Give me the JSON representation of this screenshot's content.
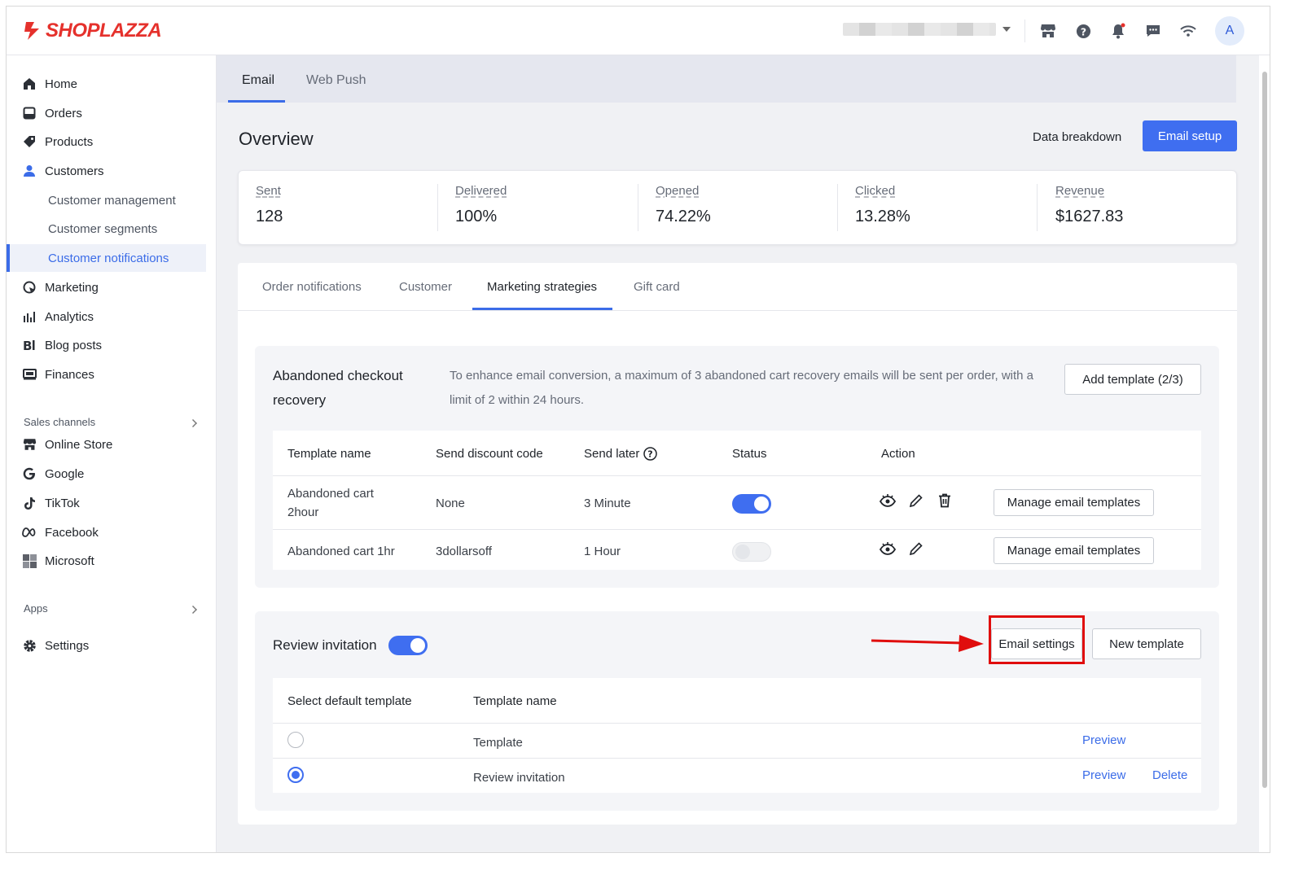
{
  "brand": {
    "name": "SHOPLAZZA",
    "color": "#e5312c"
  },
  "topbar": {
    "icons": [
      "store-icon",
      "help-icon",
      "bell-icon",
      "chat-icon",
      "wifi-icon"
    ],
    "avatar_initial": "A"
  },
  "sidebar": {
    "items": [
      {
        "label": "Home",
        "icon": "home-icon"
      },
      {
        "label": "Orders",
        "icon": "orders-icon"
      },
      {
        "label": "Products",
        "icon": "tag-icon"
      },
      {
        "label": "Customers",
        "icon": "person-icon"
      }
    ],
    "customer_sub": [
      "Customer management",
      "Customer segments",
      "Customer notifications"
    ],
    "items2": [
      {
        "label": "Marketing",
        "icon": "marketing-icon"
      },
      {
        "label": "Analytics",
        "icon": "analytics-icon"
      },
      {
        "label": "Blog posts",
        "icon": "blog-icon"
      },
      {
        "label": "Finances",
        "icon": "finances-icon"
      }
    ],
    "sales_channels_label": "Sales channels",
    "channels": [
      {
        "label": "Online Store",
        "icon": "store-icon"
      },
      {
        "label": "Google",
        "icon": "google-icon"
      },
      {
        "label": "TikTok",
        "icon": "tiktok-icon"
      },
      {
        "label": "Facebook",
        "icon": "meta-icon"
      },
      {
        "label": "Microsoft",
        "icon": "microsoft-icon"
      }
    ],
    "apps_label": "Apps",
    "settings_label": "Settings"
  },
  "main": {
    "tabs": [
      "Email",
      "Web Push"
    ],
    "title": "Overview",
    "data_breakdown": "Data breakdown",
    "email_setup": "Email setup",
    "stats": [
      {
        "label": "Sent",
        "value": "128"
      },
      {
        "label": "Delivered",
        "value": "100%"
      },
      {
        "label": "Opened",
        "value": "74.22%"
      },
      {
        "label": "Clicked",
        "value": "13.28%"
      },
      {
        "label": "Revenue",
        "value": "$1627.83"
      }
    ],
    "subtabs": [
      "Order notifications",
      "Customer",
      "Marketing strategies",
      "Gift card"
    ]
  },
  "abandoned": {
    "title_line1": "Abandoned checkout",
    "title_line2": "recovery",
    "desc": "To enhance email conversion, a maximum of 3 abandoned cart recovery emails will be sent per order, with a limit of 2 within 24 hours.",
    "add_template": "Add template (2/3)",
    "headers": [
      "Template name",
      "Send discount code",
      "Send later",
      "Status",
      "Action"
    ],
    "rows": [
      {
        "name": "Abandoned cart 2hour",
        "discount": "None",
        "later": "3 Minute",
        "status": true,
        "manage": "Manage email templates"
      },
      {
        "name": "Abandoned cart 1hr",
        "discount": "3dollarsoff",
        "later": "1 Hour",
        "status": false,
        "manage": "Manage email templates"
      }
    ]
  },
  "review": {
    "title": "Review invitation",
    "enabled": true,
    "email_settings": "Email settings",
    "new_template": "New template",
    "headers": [
      "Select default template",
      "Template name"
    ],
    "rows": [
      {
        "name": "Template",
        "selected": false,
        "preview": "Preview"
      },
      {
        "name": "Review invitation",
        "selected": true,
        "preview": "Preview",
        "delete": "Delete"
      }
    ]
  },
  "colors": {
    "accent": "#3f6ef0",
    "annotation": "#e00d0d"
  }
}
